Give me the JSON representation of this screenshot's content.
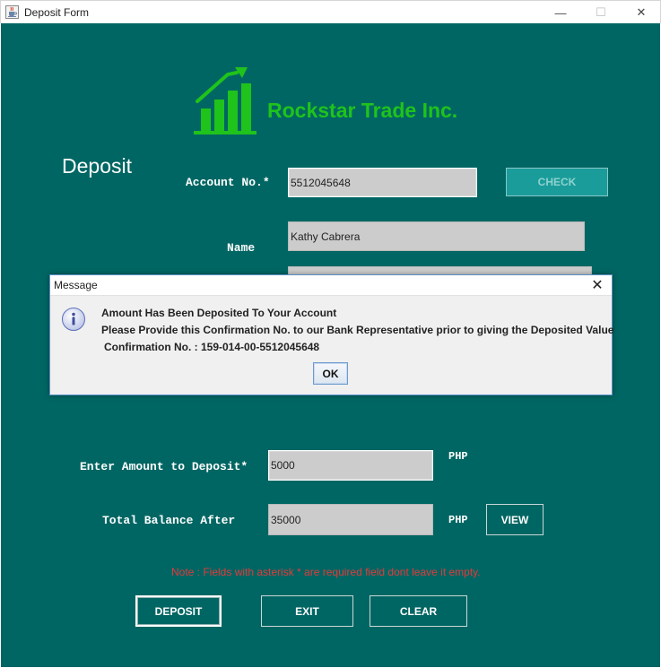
{
  "window": {
    "title": "Deposit Form",
    "minimize_glyph": "—",
    "maximize_glyph": "☐",
    "close_glyph": "✕",
    "icon": "java-cup-icon"
  },
  "header": {
    "company_name": "Rockstar Trade Inc.",
    "logo_icon": "growth-chart-icon",
    "brand_color": "#1fc31b",
    "page_heading": "Deposit"
  },
  "form": {
    "account_label": "Account No.*",
    "account_value": "5512045648",
    "check_button": "CHECK",
    "name_label": "Name",
    "name_value": "Kathy Cabrera",
    "amount_label": "Enter Amount to Deposit*",
    "amount_value": "5000",
    "amount_currency": "PHP",
    "balance_label": "Total Balance After",
    "balance_value": "35000",
    "balance_currency": "PHP",
    "view_button": "VIEW",
    "note": "Note : Fields with asterisk * are required field dont leave it empty."
  },
  "actions": {
    "deposit_button": "DEPOSIT",
    "exit_button": "EXIT",
    "clear_button": "CLEAR"
  },
  "dialog": {
    "title": "Message",
    "close_glyph": "✕",
    "icon": "info-icon",
    "line1": "Amount Has Been Deposited To Your Account",
    "line2": "Please Provide this Confirmation No. to our Bank Representative prior to giving the Deposited Value",
    "line3": "Confirmation No. : 159-014-00-5512045648",
    "ok_button": "OK"
  },
  "colors": {
    "panel_background": "#006663",
    "note_text": "#e23a3a",
    "field_background": "#cccccc"
  }
}
